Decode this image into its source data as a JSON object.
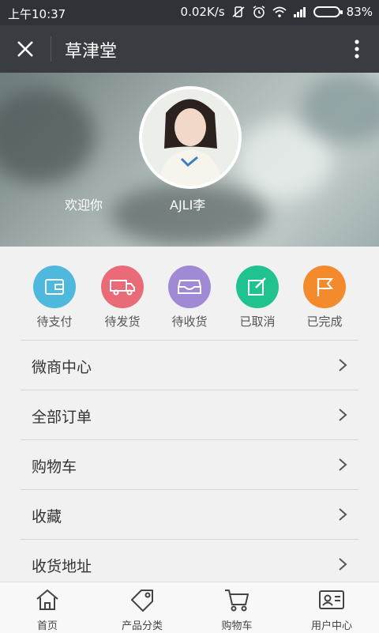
{
  "status_bar": {
    "time": "上午10:37",
    "speed": "0.02K/s",
    "battery": "83%"
  },
  "header": {
    "title": "草津堂",
    "close_icon": "close-icon",
    "more_icon": "more-vertical-icon"
  },
  "profile": {
    "welcome": "欢迎你",
    "username": "AJLI李"
  },
  "orders": [
    {
      "label": "待支付",
      "icon": "wallet-icon",
      "color": "#4fb8dd"
    },
    {
      "label": "待发货",
      "icon": "truck-icon",
      "color": "#ea6b78"
    },
    {
      "label": "待收货",
      "icon": "inbox-icon",
      "color": "#a08ad6"
    },
    {
      "label": "已取消",
      "icon": "edit-icon",
      "color": "#20c290"
    },
    {
      "label": "已完成",
      "icon": "flag-icon",
      "color": "#f38a2c"
    }
  ],
  "menu": [
    {
      "label": "微商中心"
    },
    {
      "label": "全部订单"
    },
    {
      "label": "购物车"
    },
    {
      "label": "收藏"
    },
    {
      "label": "收货地址"
    }
  ],
  "bottom_nav": [
    {
      "label": "首页",
      "icon": "home-icon"
    },
    {
      "label": "产品分类",
      "icon": "tag-icon"
    },
    {
      "label": "购物车",
      "icon": "cart-icon"
    },
    {
      "label": "用户中心",
      "icon": "user-card-icon"
    }
  ]
}
